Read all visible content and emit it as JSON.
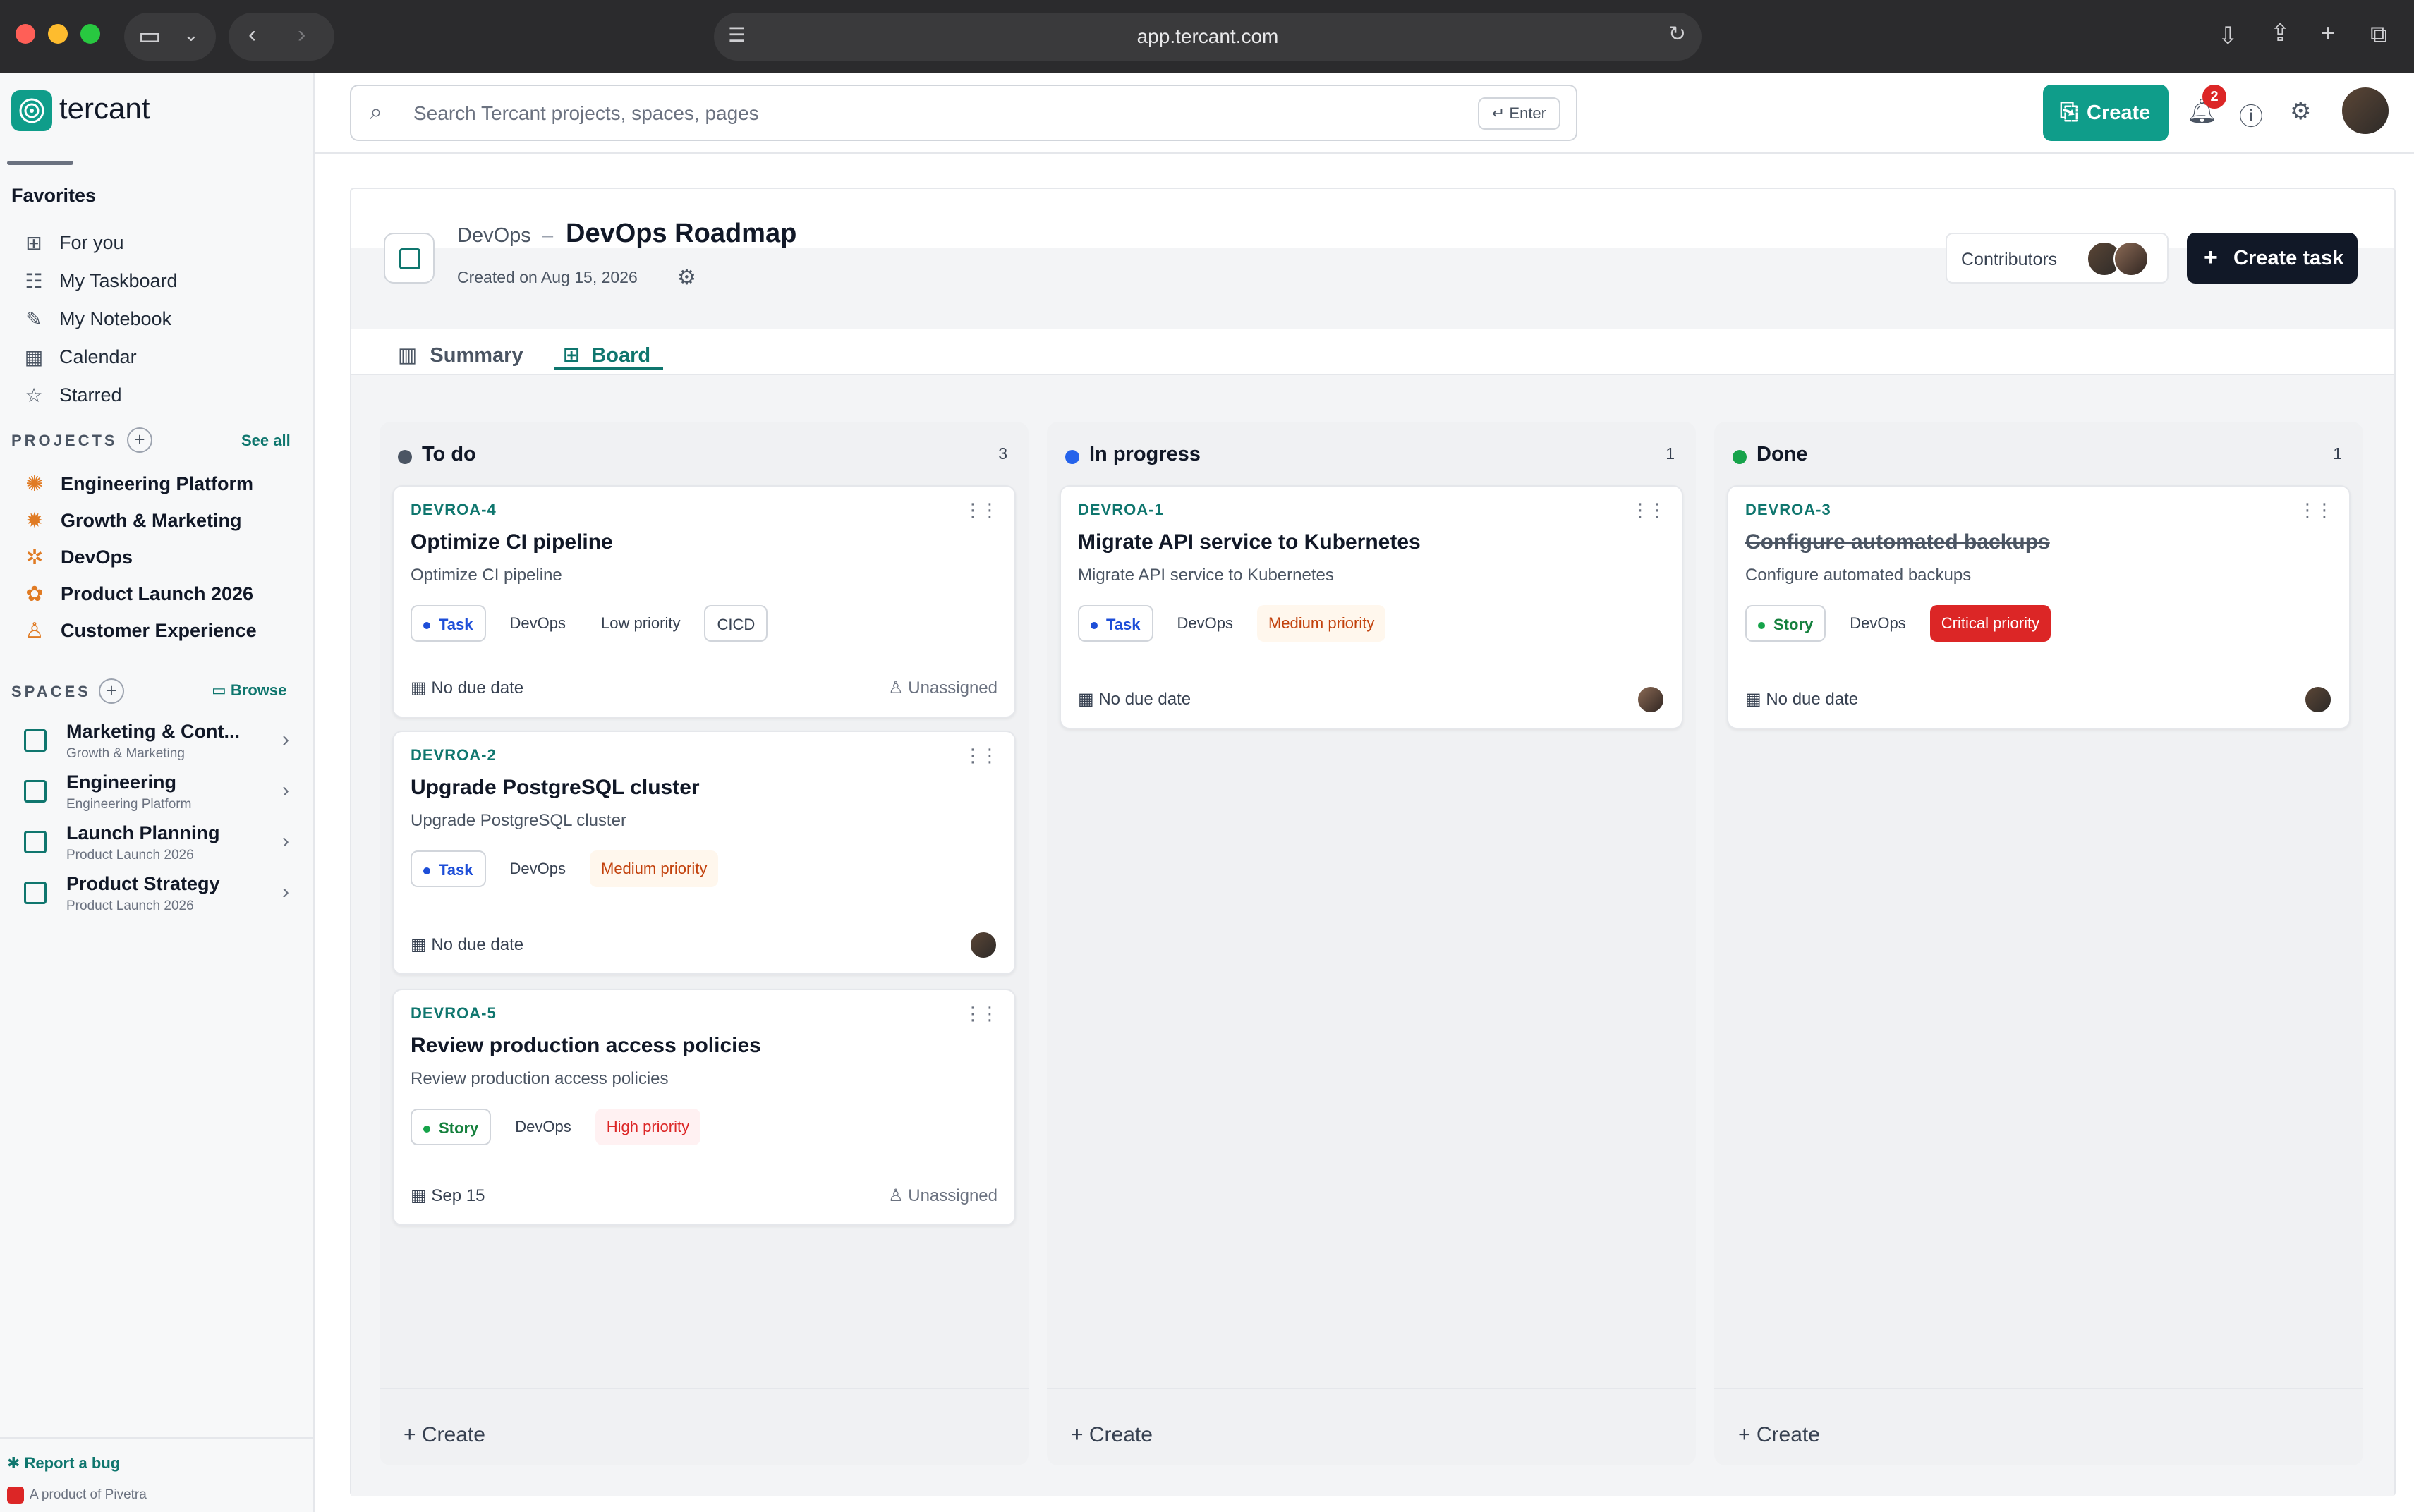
{
  "browser": {
    "url": "app.tercant.com"
  },
  "brand": {
    "name": "tercant",
    "accent": "#0f9d8a"
  },
  "sidebar": {
    "favorites_title": "Favorites",
    "favorites": [
      {
        "label": "For you",
        "icon": "grid-icon"
      },
      {
        "label": "My Taskboard",
        "icon": "taskboard-icon"
      },
      {
        "label": "My Notebook",
        "icon": "notebook-icon"
      },
      {
        "label": "Calendar",
        "icon": "calendar-icon"
      },
      {
        "label": "Starred",
        "icon": "star-icon"
      }
    ],
    "projects_title": "PROJECTS",
    "see_all": "See all",
    "projects": [
      {
        "label": "Engineering Platform"
      },
      {
        "label": "Growth & Marketing"
      },
      {
        "label": "DevOps"
      },
      {
        "label": "Product Launch 2026"
      },
      {
        "label": "Customer Experience"
      }
    ],
    "spaces_title": "SPACES",
    "browse": "Browse",
    "spaces": [
      {
        "title": "Marketing & Cont...",
        "subtitle": "Growth & Marketing"
      },
      {
        "title": "Engineering",
        "subtitle": "Engineering Platform"
      },
      {
        "title": "Launch Planning",
        "subtitle": "Product Launch 2026"
      },
      {
        "title": "Product Strategy",
        "subtitle": "Product Launch 2026"
      }
    ],
    "report_bug": "Report a bug",
    "footer": "A product of Pivetra"
  },
  "topbar": {
    "search_placeholder": "Search Tercant projects, spaces, pages",
    "enter_label": "Enter",
    "create_label": "Create",
    "notification_count": "2"
  },
  "page": {
    "breadcrumb_parent": "DevOps",
    "breadcrumb_sep": "–",
    "title": "DevOps Roadmap",
    "created": "Created on Aug 15, 2026",
    "contributors_label": "Contributors",
    "create_task_label": "Create task",
    "tabs": [
      {
        "label": "Summary"
      },
      {
        "label": "Board"
      }
    ],
    "active_tab": "Board"
  },
  "board": {
    "create_label": "Create",
    "columns": [
      {
        "title": "To do",
        "count": "3",
        "dot": "#4b5563",
        "cards": [
          {
            "key": "DEVROA-4",
            "title": "Optimize CI pipeline",
            "desc": "Optimize CI pipeline",
            "type": "Task",
            "project": "DevOps",
            "priority": "Low priority",
            "label": "CICD",
            "due": "No due date",
            "assignee": "Unassigned"
          },
          {
            "key": "DEVROA-2",
            "title": "Upgrade PostgreSQL cluster",
            "desc": "Upgrade PostgreSQL cluster",
            "type": "Task",
            "project": "DevOps",
            "priority": "Medium priority",
            "due": "No due date"
          },
          {
            "key": "DEVROA-5",
            "title": "Review production access policies",
            "desc": "Review production access policies",
            "type": "Story",
            "project": "DevOps",
            "priority": "High priority",
            "due": "Sep 15",
            "assignee": "Unassigned"
          }
        ]
      },
      {
        "title": "In progress",
        "count": "1",
        "dot": "#2563eb",
        "cards": [
          {
            "key": "DEVROA-1",
            "title": "Migrate API service to Kubernetes",
            "desc": "Migrate API service to Kubernetes",
            "type": "Task",
            "project": "DevOps",
            "priority": "Medium priority",
            "due": "No due date"
          }
        ]
      },
      {
        "title": "Done",
        "count": "1",
        "dot": "#16a34a",
        "cards": [
          {
            "key": "DEVROA-3",
            "title": "Configure automated backups",
            "desc": "Configure automated backups",
            "type": "Story",
            "project": "DevOps",
            "priority": "Critical priority",
            "due": "No due date"
          }
        ]
      }
    ]
  }
}
